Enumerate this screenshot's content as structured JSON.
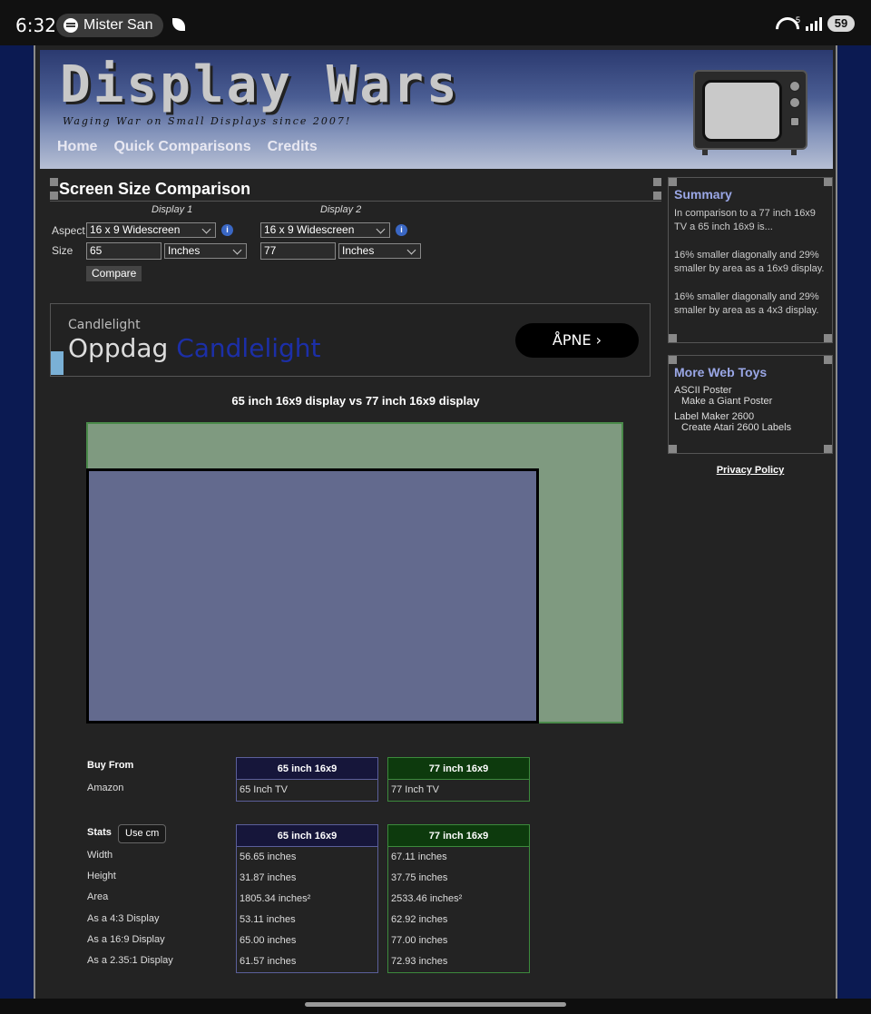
{
  "status_bar": {
    "time": "6:32",
    "media_label": "Mister San",
    "battery": "59",
    "wifi_badge": "5"
  },
  "header": {
    "logo": "Display Wars",
    "tagline": "Waging War on Small Displays since 2007!",
    "nav": [
      "Home",
      "Quick Comparisons",
      "Credits"
    ]
  },
  "form": {
    "title": "Screen Size Comparison",
    "display1_label": "Display 1",
    "display2_label": "Display 2",
    "aspect_label": "Aspect",
    "size_label": "Size",
    "display1_aspect": "16 x 9 Widescreen",
    "display2_aspect": "16 x 9 Widescreen",
    "display1_size": "65",
    "display2_size": "77",
    "display1_unit": "Inches",
    "display2_unit": "Inches",
    "compare_button": "Compare",
    "info_glyph": "i"
  },
  "ad": {
    "brand": "Candlelight",
    "headline_prefix": "Oppdag",
    "headline_highlight": "Candlelight",
    "cta": "ÅPNE"
  },
  "comparison": {
    "title": "65 inch 16x9 display vs 77 inch 16x9 display",
    "area_ratio_small_to_big": 0.7125
  },
  "buy": {
    "label": "Buy From",
    "row_label": "Amazon",
    "col1_head": "65 inch 16x9",
    "col2_head": "77 inch 16x9",
    "col1_value": "65 Inch TV",
    "col2_value": "77 Inch TV"
  },
  "stats": {
    "label": "Stats",
    "use_cm": "Use cm",
    "col1_head": "65 inch 16x9",
    "col2_head": "77 inch 16x9",
    "rows": [
      {
        "label": "Width",
        "v1": "56.65 inches",
        "v2": "67.11 inches"
      },
      {
        "label": "Height",
        "v1": "31.87 inches",
        "v2": "37.75 inches"
      },
      {
        "label": "Area",
        "v1": "1805.34 inches²",
        "v2": "2533.46 inches²"
      },
      {
        "label": "As a 4:3 Display",
        "v1": "53.11 inches",
        "v2": "62.92 inches"
      },
      {
        "label": "As a 16:9 Display",
        "v1": "65.00 inches",
        "v2": "77.00 inches"
      },
      {
        "label": "As a 2.35:1 Display",
        "v1": "61.57 inches",
        "v2": "72.93 inches"
      }
    ]
  },
  "summary": {
    "title": "Summary",
    "intro": "In comparison to a 77 inch 16x9 TV a 65 inch 16x9 is...",
    "line1": "16% smaller diagonally and 29% smaller by area as a 16x9 display.",
    "line2": "16% smaller diagonally and 29% smaller by area as a 4x3 display."
  },
  "toys": {
    "title": "More Web Toys",
    "items": [
      {
        "name": "ASCII Poster",
        "desc": "Make a Giant Poster"
      },
      {
        "name": "Label Maker 2600",
        "desc": "Create Atari 2600 Labels"
      }
    ]
  },
  "privacy": "Privacy Policy"
}
